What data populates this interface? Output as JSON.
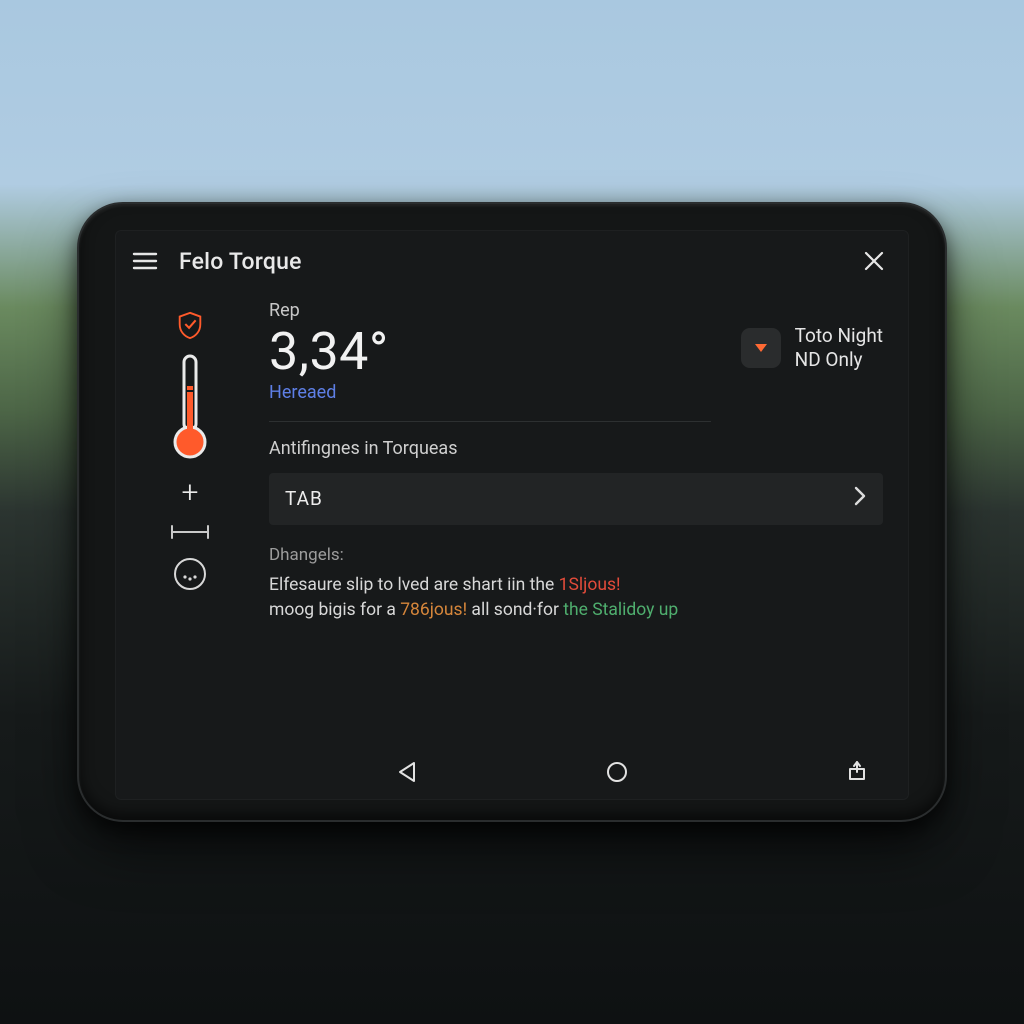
{
  "header": {
    "title": "Felo Torque"
  },
  "reading": {
    "label": "Rep",
    "value": "3,34°",
    "sub": "Hereaed"
  },
  "mode": {
    "line1": "Toto Night",
    "line2": "ND Only"
  },
  "section": {
    "label": "Antifingnes in Torqueas",
    "tab_label": "TAB"
  },
  "diag": {
    "label": "Dhangels:",
    "t1": "Elfesaure slip to lved are shart iin the ",
    "r1": "1Sljous!",
    "t2": " moog bigis for a ",
    "r2": "786jous!",
    "t3": " all sond·for ",
    "g1": "the Stalidoy up"
  },
  "icons": {
    "menu": "menu-icon",
    "close": "close-icon",
    "shield": "shield-check-icon",
    "thermo": "thermometer-icon",
    "plus": "plus-icon",
    "adjust": "adjust-line-icon",
    "face": "face-icon",
    "mode_chev": "chevron-down-icon",
    "row_chev": "chevron-right-icon",
    "back": "nav-back-icon",
    "home": "nav-home-icon",
    "share": "share-icon"
  },
  "colors": {
    "accent_orange": "#ff5a2b",
    "link_blue": "#5e7fe6",
    "warn_red": "#e24b3a",
    "ok_green": "#4fae6e",
    "bg": "#17191a"
  }
}
